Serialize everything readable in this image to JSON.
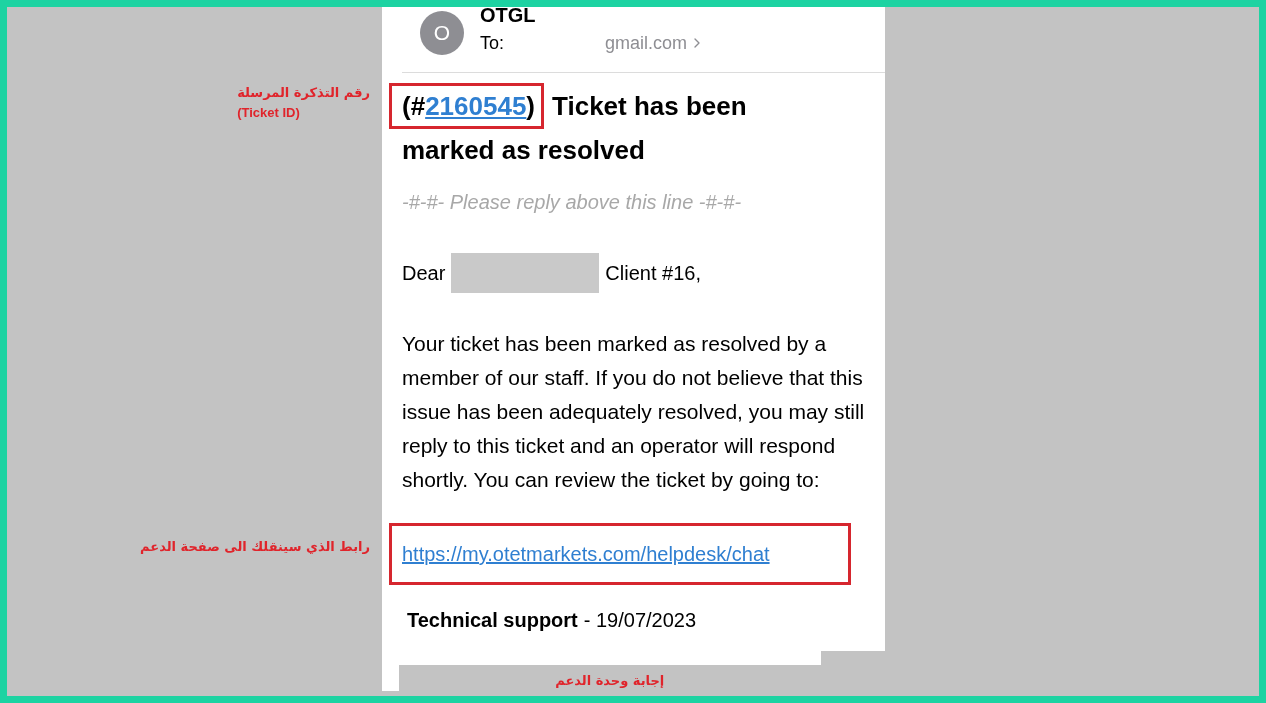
{
  "header": {
    "avatar_letter": "O",
    "sender": "OTGL",
    "to_label": "To:",
    "to_value": "gmail.com"
  },
  "title": {
    "ticket_prefix": "(#",
    "ticket_id": "2160545",
    "ticket_suffix": ")",
    "lines": [
      "Ticket has been",
      "marked as resolved"
    ]
  },
  "reply_line": "-#-#- Please reply above this line -#-#-",
  "greeting": {
    "before": "Dear",
    "after": "Client #16,"
  },
  "body": "Your ticket has been marked as resolved by a member of our staff. If you do not believe that this issue has been adequately resolved, you may still reply to this ticket and an operator will respond shortly. You can review the ticket by going to:",
  "link": "https://my.otetmarkets.com/helpdesk/chat",
  "signature": {
    "name": "Technical support",
    "date": "- 19/07/2023"
  },
  "annotations": {
    "ticket_id": [
      "رقم التذكرة المرسلة",
      "(Ticket ID)"
    ],
    "link": "رابط الذي سينقلك الى صفحة الدعم",
    "reply": "إجابة وحدة الدعم"
  }
}
